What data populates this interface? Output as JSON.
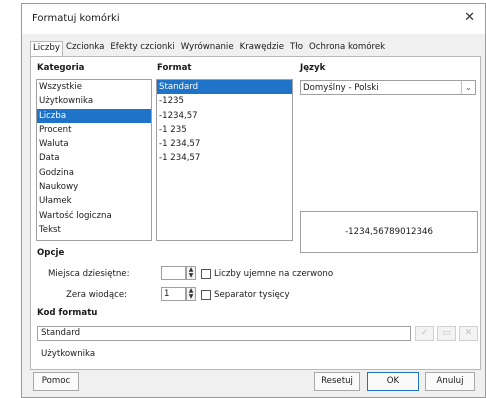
{
  "dialog": {
    "title": "Formatuj komórki"
  },
  "tabs": [
    "Liczby",
    "Czcionka",
    "Efekty czcionki",
    "Wyrównanie",
    "Krawędzie",
    "Tło",
    "Ochrona komórek"
  ],
  "kategoria": {
    "header": "Kategoria",
    "items": [
      "Wszystkie",
      "Użytkownika",
      "Liczba",
      "Procent",
      "Waluta",
      "Data",
      "Godzina",
      "Naukowy",
      "Ułamek",
      "Wartość logiczna",
      "Tekst"
    ],
    "selected": "Liczba"
  },
  "format": {
    "header": "Format",
    "items": [
      "Standard",
      "-1235",
      "-1234,57",
      "-1 235",
      "-1 234,57",
      "-1 234,57"
    ],
    "selected": "Standard"
  },
  "jezyk": {
    "header": "Język",
    "value": "Domyślny - Polski"
  },
  "preview": {
    "value": "-1234,56789012346"
  },
  "opcje": {
    "header": "Opcje",
    "miejsca_label": "Miejsca dziesiętne:",
    "miejsca_value": "",
    "zera_label": "Zera wiodące:",
    "zera_value": "1",
    "czerwono_label": "Liczby ujemne na czerwono",
    "czerwono_checked": false,
    "separator_label": "Separator tysięcy",
    "separator_checked": false
  },
  "kod": {
    "header": "Kod formatu",
    "value": "Standard",
    "comment": "Użytkownika"
  },
  "buttons": {
    "help": "Pomoc",
    "reset": "Resetuj",
    "ok": "OK",
    "cancel": "Anuluj"
  },
  "colors": {
    "selection": "#1f73c9",
    "dialog_bg": "#f0f0f0"
  }
}
